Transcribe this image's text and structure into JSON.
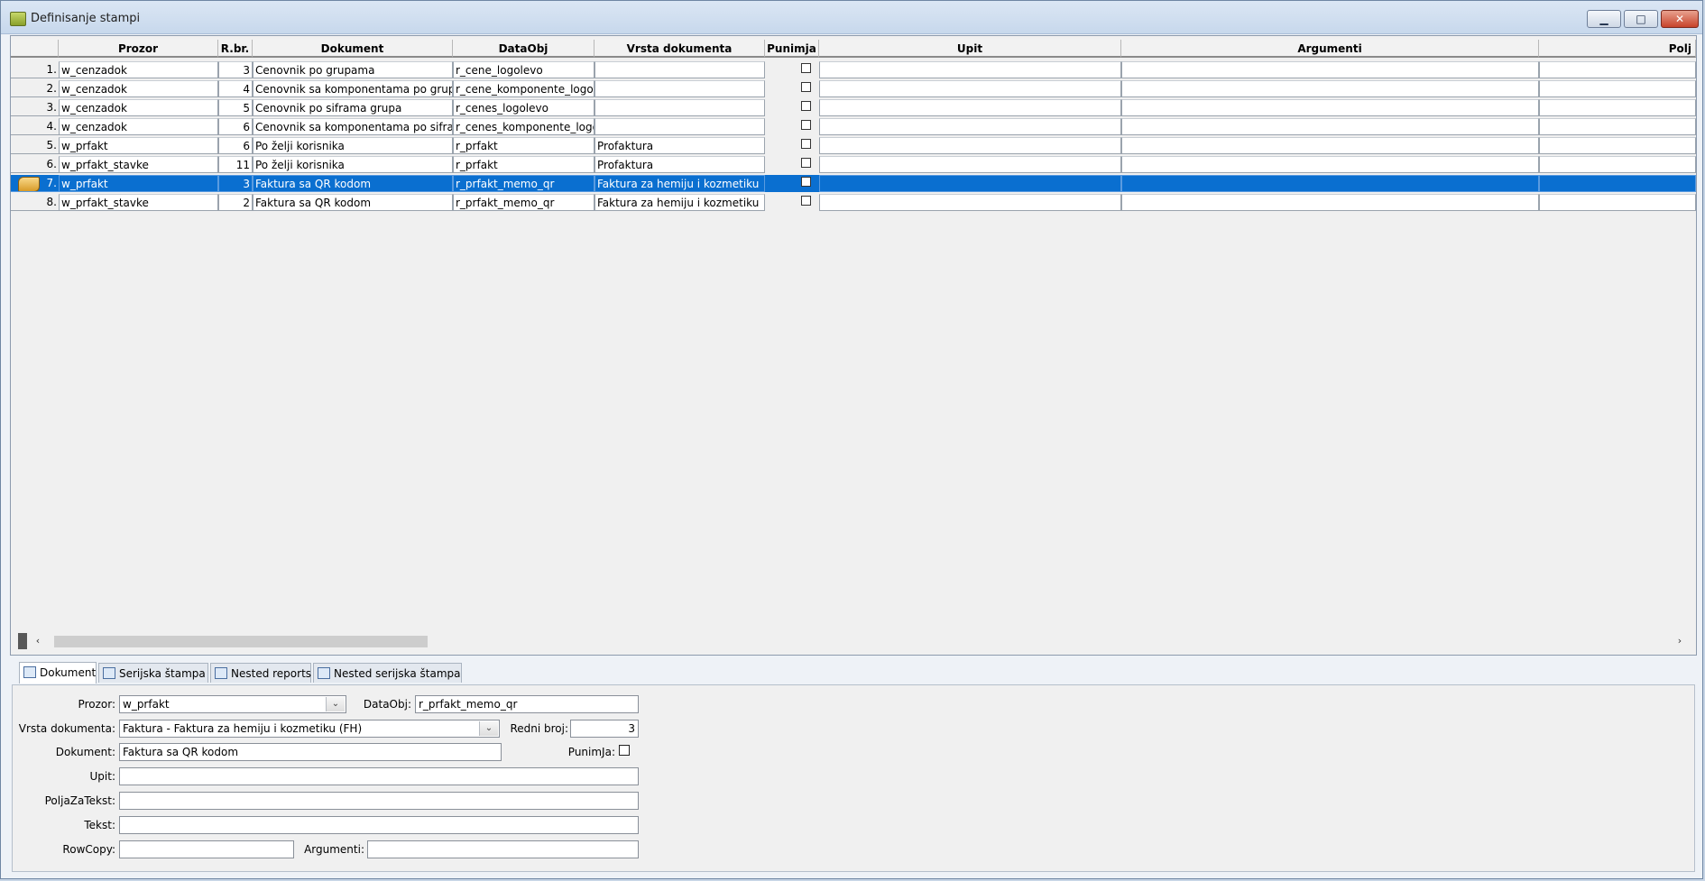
{
  "window": {
    "title": "Definisanje stampi",
    "min_glyph": "▁",
    "max_glyph": "□",
    "close_glyph": "✕"
  },
  "grid": {
    "columns": [
      "Prozor",
      "R.br.",
      "Dokument",
      "DataObj",
      "Vrsta dokumenta",
      "Punimja",
      "Upit",
      "Argumenti",
      "Polj"
    ],
    "rows": [
      {
        "idx": "1.",
        "prozor": "w_cenzadok",
        "rbr": "3",
        "dokument": "Cenovnik po grupama",
        "dataobj": "r_cene_logolevo",
        "vrsta": "",
        "punimja": false
      },
      {
        "idx": "2.",
        "prozor": "w_cenzadok",
        "rbr": "4",
        "dokument": "Cenovnik sa komponentama po grupama",
        "dataobj": "r_cene_komponente_logolevo",
        "vrsta": "",
        "punimja": false
      },
      {
        "idx": "3.",
        "prozor": "w_cenzadok",
        "rbr": "5",
        "dokument": "Cenovnik po siframa grupa",
        "dataobj": "r_cenes_logolevo",
        "vrsta": "",
        "punimja": false
      },
      {
        "idx": "4.",
        "prozor": "w_cenzadok",
        "rbr": "6",
        "dokument": "Cenovnik sa komponentama po siframa",
        "dataobj": "r_cenes_komponente_logolevo",
        "vrsta": "",
        "punimja": false
      },
      {
        "idx": "5.",
        "prozor": "w_prfakt",
        "rbr": "6",
        "dokument": "Po želji korisnika",
        "dataobj": "r_prfakt",
        "vrsta": "Profaktura",
        "punimja": false
      },
      {
        "idx": "6.",
        "prozor": "w_prfakt_stavke",
        "rbr": "11",
        "dokument": "Po želji korisnika",
        "dataobj": "r_prfakt",
        "vrsta": "Profaktura",
        "punimja": false
      },
      {
        "idx": "7.",
        "prozor": "w_prfakt",
        "rbr": "3",
        "dokument": "Faktura sa QR kodom",
        "dataobj": "r_prfakt_memo_qr",
        "vrsta": "Faktura za hemiju i kozmetiku",
        "punimja": false,
        "selected": true
      },
      {
        "idx": "8.",
        "prozor": "w_prfakt_stavke",
        "rbr": "2",
        "dokument": "Faktura sa QR kodom",
        "dataobj": "r_prfakt_memo_qr",
        "vrsta": "Faktura za hemiju i kozmetiku",
        "punimja": false
      }
    ],
    "scroll_left": "‹",
    "scroll_right": "›"
  },
  "tabs": [
    {
      "label": "Dokument",
      "icon": "document-icon",
      "active": true
    },
    {
      "label": "Serijska štampa",
      "icon": "serial-print-icon"
    },
    {
      "label": "Nested reports",
      "icon": "nested-reports-icon"
    },
    {
      "label": "Nested serijska štampa",
      "icon": "nested-serial-icon"
    }
  ],
  "form": {
    "prozor_label": "Prozor:",
    "prozor_value": "w_prfakt",
    "dataobj_label": "DataObj:",
    "dataobj_value": "r_prfakt_memo_qr",
    "vrsta_label": "Vrsta dokumenta:",
    "vrsta_value": "Faktura  -  Faktura za hemiju i kozmetiku (FH)",
    "redni_label": "Redni broj:",
    "redni_value": "3",
    "dokument_label": "Dokument:",
    "dokument_value": "Faktura sa QR kodom",
    "punimja_label": "PunimJa:",
    "upit_label": "Upit:",
    "upit_value": "",
    "poljazatekst_label": "PoljaZaTekst:",
    "poljazatekst_value": "",
    "tekst_label": "Tekst:",
    "tekst_value": "",
    "rowcopy_label": "RowCopy:",
    "rowcopy_value": "",
    "argumenti_label": "Argumenti:",
    "argumenti_value": "",
    "dropdown_glyph": "⌄"
  }
}
